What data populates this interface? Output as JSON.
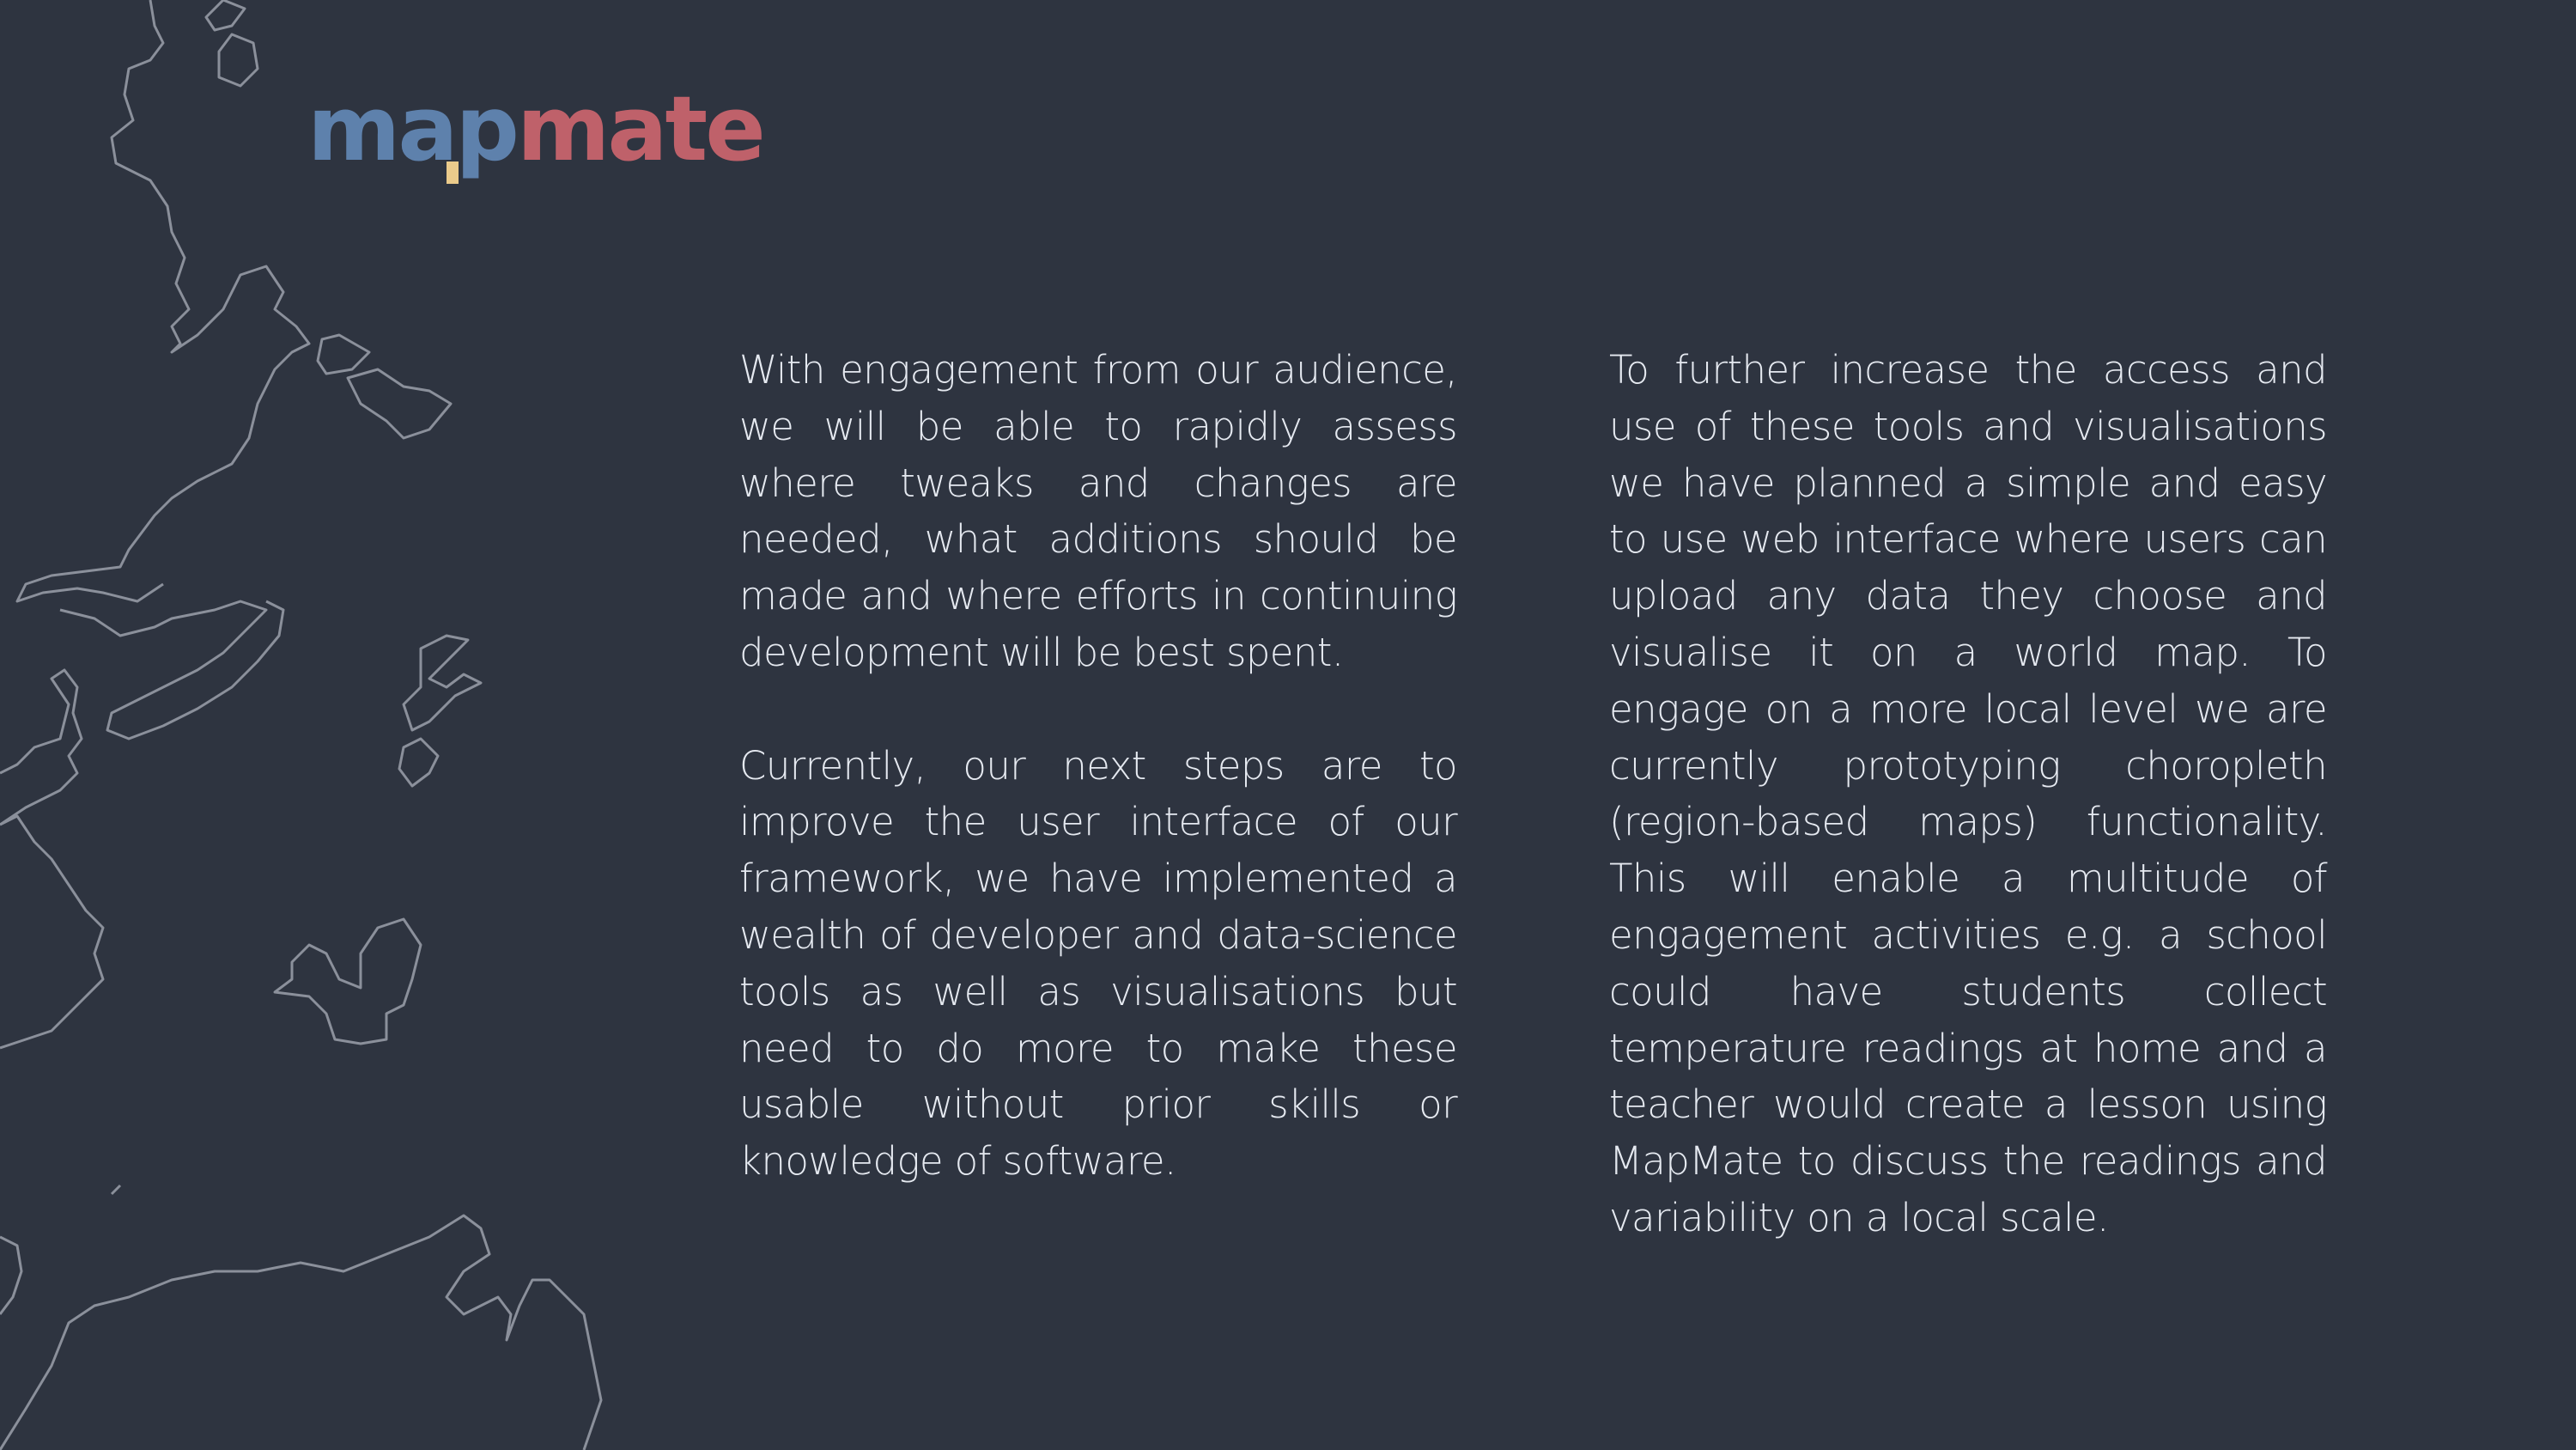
{
  "logo": {
    "part1": "map",
    "part2": "mate",
    "colors": {
      "blue": "#5e81ac",
      "red": "#bf616a",
      "yellow": "#ebcb8b"
    }
  },
  "column1": {
    "paragraphs": [
      "With engagement from our audience, we will be able to rapidly assess where tweaks and changes are needed, what additions should be made and where efforts in continuing development will be best spent.",
      "Currently, our next steps are to improve the user interface of our framework, we have implemented a wealth of developer and data-science tools as well as visualisations but need to do more to make these usable without prior skills or knowledge of software."
    ]
  },
  "column2": {
    "paragraphs": [
      "To further increase the access and use of these tools and visualisations we have planned a simple and easy to use web interface where users can upload any data they choose and visualise it on a world map. To engage on a more local level we are currently prototyping choropleth (region-based maps) functionality. This will enable a multitude of engagement activities e.g. a school could have students collect temperature readings at home and a teacher would create a lesson using MapMate to discuss the readings and variability on a local scale."
    ]
  }
}
